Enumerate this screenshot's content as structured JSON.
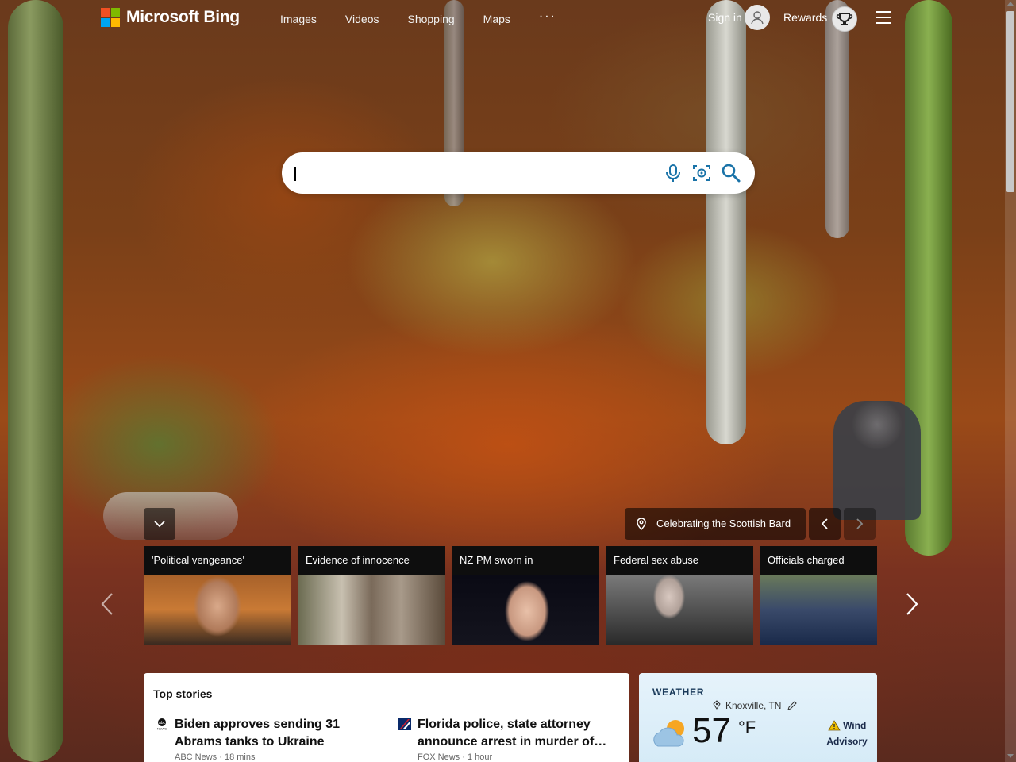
{
  "brand": {
    "name": "Microsoft Bing"
  },
  "nav": {
    "items": [
      "Images",
      "Videos",
      "Shopping",
      "Maps"
    ],
    "more": "···"
  },
  "account": {
    "sign_in": "Sign in",
    "rewards": "Rewards"
  },
  "search": {
    "value": "",
    "placeholder": ""
  },
  "image_info": {
    "title": "Celebrating the Scottish Bard"
  },
  "news_cards": [
    {
      "caption": "'Political vengeance'"
    },
    {
      "caption": "Evidence of innocence"
    },
    {
      "caption": "NZ PM sworn in"
    },
    {
      "caption": "Federal sex abuse"
    },
    {
      "caption": "Officials charged"
    }
  ],
  "top_stories": {
    "title": "Top stories",
    "items": [
      {
        "headline": "Biden approves sending 31 Abrams tanks to Ukraine",
        "source": "ABC News",
        "time": "18 mins"
      },
      {
        "headline": "Florida police, state attorney announce arrest in murder of…",
        "source": "FOX News",
        "time": "1 hour"
      }
    ]
  },
  "weather": {
    "title": "WEATHER",
    "location": "Knoxville, TN",
    "temperature": "57",
    "unit": "°F",
    "alert": "Wind Advisory"
  },
  "colors": {
    "ms_red": "#f25022",
    "ms_green": "#7fba00",
    "ms_blue": "#00a4ef",
    "ms_yellow": "#ffb900",
    "search_icon_blue": "#1a73a8"
  },
  "icons": [
    "microphone-icon",
    "visual-search-icon",
    "search-icon",
    "location-pin-icon",
    "chevron-left-icon",
    "chevron-right-icon",
    "chevron-down-icon",
    "hamburger-menu-icon",
    "user-avatar-icon",
    "rewards-trophy-icon",
    "partly-cloudy-icon",
    "warning-icon",
    "edit-pencil-icon"
  ]
}
